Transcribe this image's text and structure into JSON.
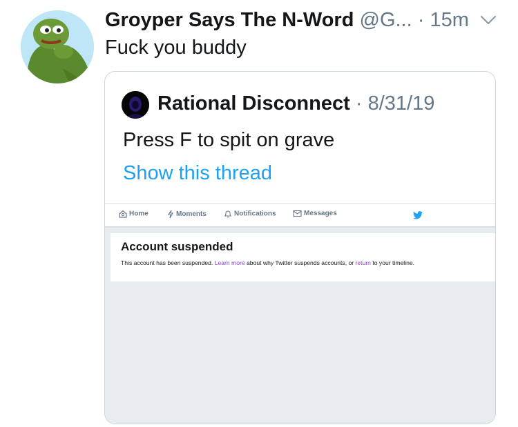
{
  "tweet": {
    "display_name": "Groyper Says The N-Word",
    "handle": "@G...",
    "separator": "·",
    "time": "15m",
    "text": "Fuck you buddy"
  },
  "quoted_tweet": {
    "display_name": "Rational Disconnect",
    "separator": "·",
    "date": "8/31/19",
    "text": "Press F to spit on grave",
    "show_thread": "Show this thread"
  },
  "screenshot": {
    "nav": {
      "home": "Home",
      "moments": "Moments",
      "notifications": "Notifications",
      "messages": "Messages"
    },
    "suspended": {
      "title": "Account suspended",
      "text_before": "This account has been suspended. ",
      "learn_more": "Learn more",
      "text_middle": " about why Twitter suspends accounts, or ",
      "return_link": "return",
      "text_after": " to your timeline."
    }
  },
  "colors": {
    "link_blue": "#1da1f2",
    "muted_gray": "#657786",
    "link_purple": "#8a3bd2"
  },
  "icons": [
    "avatar-frog",
    "chevron-down-icon",
    "home-icon",
    "moments-icon",
    "bell-icon",
    "mail-icon",
    "twitter-bird-icon"
  ]
}
